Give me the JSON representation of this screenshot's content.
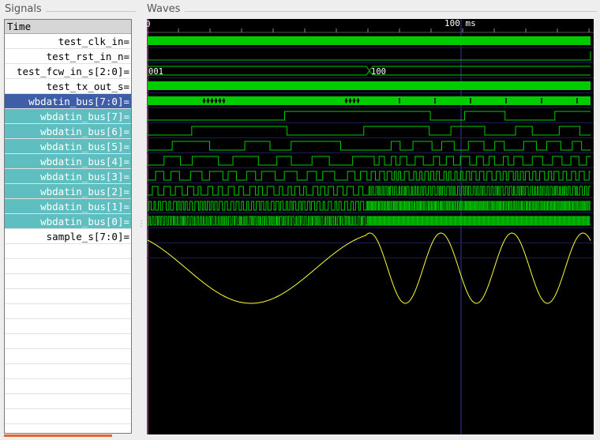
{
  "panels": {
    "signals_title": "Signals",
    "waves_title": "Waves"
  },
  "time_header": "Time",
  "signals": [
    {
      "label": "test_clk_in",
      "style": "normal"
    },
    {
      "label": "test_rst_in_n",
      "style": "normal"
    },
    {
      "label": "test_fcw_in_s[2:0]",
      "style": "normal"
    },
    {
      "label": "test_tx_out_s",
      "style": "normal"
    },
    {
      "label": "wbdatin_bus[7:0]",
      "style": "selected"
    },
    {
      "label": "wbdatin_bus[7]",
      "style": "child"
    },
    {
      "label": "wbdatin_bus[6]",
      "style": "child"
    },
    {
      "label": "wbdatin_bus[5]",
      "style": "child"
    },
    {
      "label": "wbdatin_bus[4]",
      "style": "child"
    },
    {
      "label": "wbdatin_bus[3]",
      "style": "child"
    },
    {
      "label": "wbdatin_bus[2]",
      "style": "child"
    },
    {
      "label": "wbdatin_bus[1]",
      "style": "child"
    },
    {
      "label": "wbdatin_bus[0]",
      "style": "child"
    },
    {
      "label": "sample_s[7:0]",
      "style": "normal"
    }
  ],
  "empty_rows": 12,
  "timeline": {
    "start_label": "0",
    "marker_label": "100 ms"
  },
  "fcw_values": [
    "001",
    "100"
  ],
  "colors": {
    "wave_green": "#00cc00",
    "wave_yellow": "#ffff33",
    "cursor_blue": "#3a3aa0",
    "marker_pink": "#ff66cc",
    "selected_row": "#3e5fa8",
    "child_row": "#5fbfc0"
  }
}
